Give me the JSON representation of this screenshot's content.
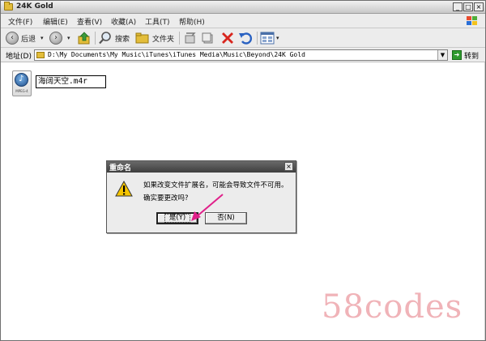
{
  "window": {
    "title": "24K Gold"
  },
  "title_buttons": {
    "minimize": "_",
    "maximize": "□",
    "close": "×"
  },
  "menu": {
    "items": [
      "文件(F)",
      "编辑(E)",
      "查看(V)",
      "收藏(A)",
      "工具(T)",
      "帮助(H)"
    ]
  },
  "toolbar": {
    "back_label": "后退",
    "search_label": "搜索",
    "folders_label": "文件夹"
  },
  "address": {
    "label": "地址(D)",
    "path": "D:\\My Documents\\My Music\\iTunes\\iTunes Media\\Music\\Beyond\\24K Gold",
    "go_label": "转到"
  },
  "file": {
    "type_label": "MPEG-4",
    "rename_value": "海阔天空.m4r"
  },
  "dialog": {
    "title": "重命名",
    "message1": "如果改变文件扩展名，可能会导致文件不可用。",
    "message2": "确实要更改吗?",
    "yes_label": "是(Y)",
    "no_label": "否(N)",
    "close_glyph": "×"
  },
  "watermark": {
    "text": "58codes"
  },
  "colors": {
    "arrow": "#e0208a",
    "watermark": "#f0b3b8",
    "warning": "#f5c400"
  }
}
